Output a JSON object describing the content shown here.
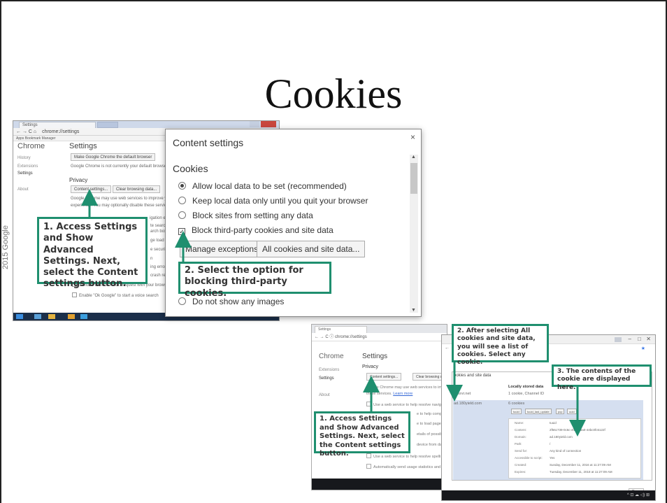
{
  "slide": {
    "title": "Cookies",
    "copyright": "2015 Google"
  },
  "screenshot1": {
    "tab_label": "Settings",
    "url": "chrome://settings",
    "bookmarks_bar": "Apps   Bookmark Manager",
    "app_name": "Chrome",
    "page_title": "Settings",
    "nav": [
      "History",
      "Extensions",
      "Settings",
      "About"
    ],
    "default_browser_button": "Make Google Chrome the default browser",
    "default_browser_text": "Google Chrome is not currently your default browser",
    "privacy_heading": "Privacy",
    "content_settings_button": "Content settings...",
    "clear_browsing_button": "Clear browsing data...",
    "privacy_text_1": "Google Chrome may use web services to improve your",
    "privacy_text_2": "experience. You may optionally disable these services.",
    "partial_lines": [
      "igation err",
      "te search",
      "arch box",
      "ge load p",
      "e security",
      "n",
      "ing errors",
      "crash re"
    ],
    "dnt_option": "Send a \"Do Not Track\" request with your browsing traffic",
    "ok_google_option": "Enable \"Ok Google\" to start a voice search"
  },
  "content_settings_dialog": {
    "title": "Content settings",
    "close": "×",
    "section": "Cookies",
    "options": [
      "Allow local data to be set (recommended)",
      "Keep local data only until you quit your browser",
      "Block sites from setting any data"
    ],
    "block_third_party": "Block third-party cookies and site data",
    "checkbox_mark": "✓",
    "manage_exceptions": "Manage exceptions...",
    "all_cookies": "All cookies and site data...",
    "images_option": "Do not show any images",
    "scroll_up": "▲",
    "scroll_down": "▼"
  },
  "screenshot2": {
    "tab_label": "Settings",
    "url": "chrome://settings",
    "app_name": "Chrome",
    "page_title": "Settings",
    "nav": [
      "Extensions",
      "Settings",
      "About"
    ],
    "privacy_heading": "Privacy",
    "content_settings_button": "Content settings...",
    "clear_browsing_button": "Clear browsing da",
    "privacy_text_1": "Google Chrome may use web services to im",
    "privacy_text_2": "these services.",
    "learn_more": "Learn more",
    "checks": [
      "Use a web service to help resolve navig",
      "e to help comple",
      "e to load pages",
      "etails of possible",
      "device from dang",
      "Use a web service to help resolve spelli",
      "Automatically send usage statistics and"
    ]
  },
  "cookies_window": {
    "minimize": "–",
    "maximize": "□",
    "close": "✕",
    "star": "★",
    "back": "←",
    "header": "ookies and site data",
    "col_site": "Site",
    "col_data": "Locally stored data",
    "rows": [
      {
        "site": "adsrvr.net",
        "data": "1 cookie, Channel ID"
      },
      {
        "site": "ad.180yield.com",
        "data": "6 cookies"
      }
    ],
    "chips": [
      "tuuid",
      "tuuid_last_update",
      "pcp",
      "uuid"
    ],
    "details": [
      {
        "label": "Name:",
        "value": "tuuid"
      },
      {
        "label": "Content:",
        "value": "2f56c739-0c6c-4f85-a9a0-44bc0fc6122f"
      },
      {
        "label": "Domain:",
        "value": "ad.180yield.com"
      },
      {
        "label": "Path:",
        "value": "/"
      },
      {
        "label": "Send for:",
        "value": "Any kind of connection"
      },
      {
        "label": "Accessible to script:",
        "value": "Yes"
      },
      {
        "label": "Created:",
        "value": "Sunday, December 11, 2016 at 11:27:09 AM"
      },
      {
        "label": "Expires:",
        "value": "Tuesday, December 11, 2018 at 11:27:09 AM"
      }
    ],
    "done": "Done",
    "tray": "^ ⊡ ☁ ◁) ⊞"
  },
  "callouts": {
    "c1": "1. Access Settings and Show Advanced Settings. Next, select the Content settings button.",
    "c2": "2. Select the option for blocking third-party cookies.",
    "c3": "1. Access Settings and Show Advanced Settings. Next, select the Content settings button.",
    "c4": "2. After selecting All cookies and site data, you will see a list of cookies. Select any cookie.",
    "c5": "3. The contents of the cookie are displayed here."
  },
  "colors": {
    "callout_border": "#1f8f6f",
    "arrow": "#1f8f6f"
  }
}
